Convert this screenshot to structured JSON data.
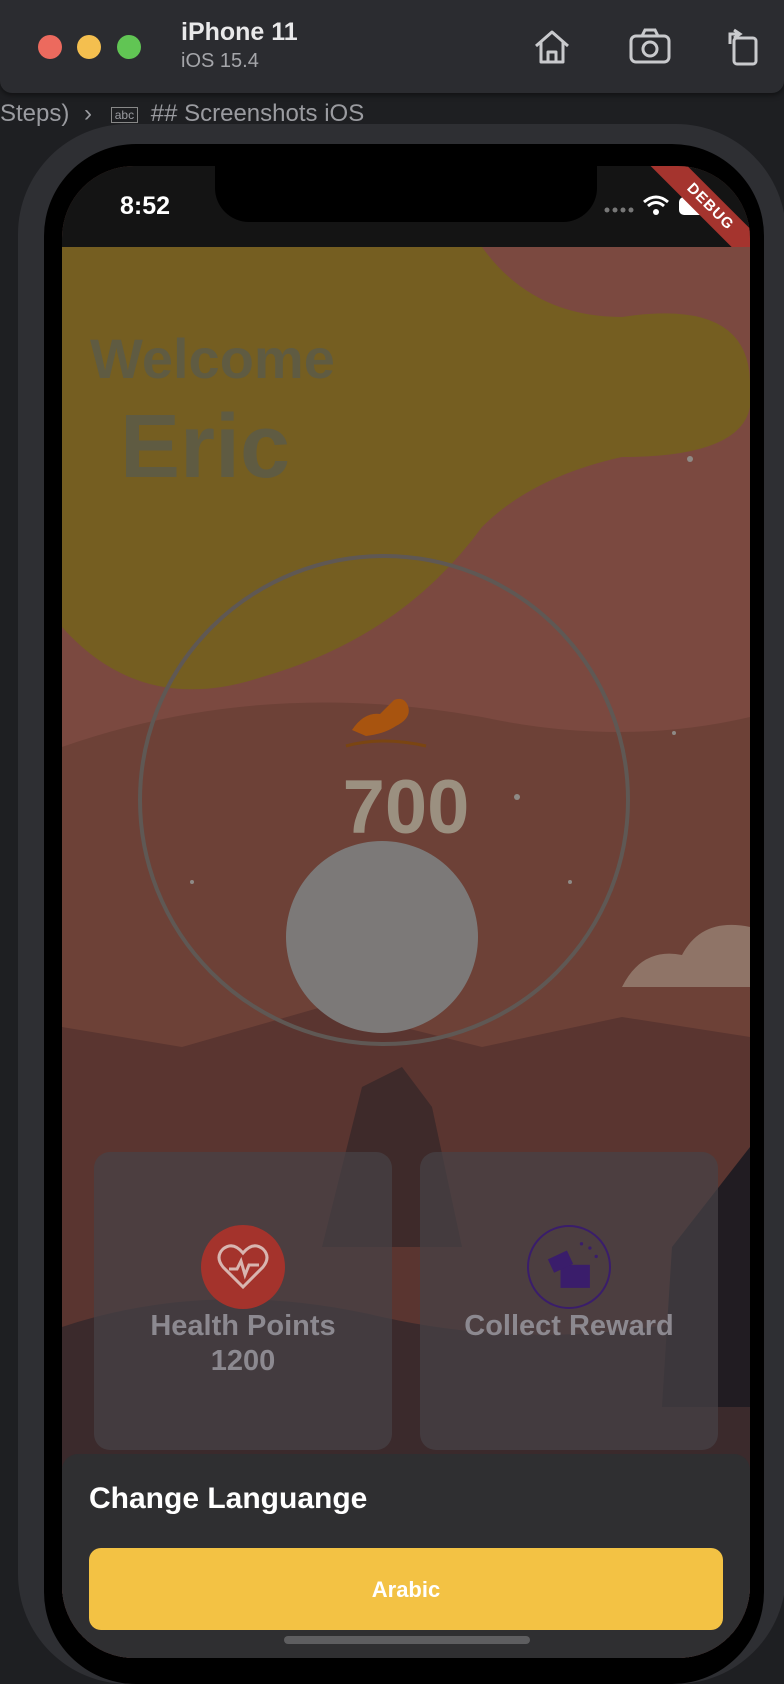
{
  "simulator": {
    "device_name": "iPhone 11",
    "os_version": "iOS 15.4",
    "toolbar": {
      "home": "home-icon",
      "screenshot": "camera-icon",
      "rotate": "rotate-icon"
    }
  },
  "editor": {
    "breadcrumb_left": "Steps)",
    "breadcrumb_abc": "abc",
    "breadcrumb_heading": "## Screenshots iOS"
  },
  "status_bar": {
    "time": "8:52",
    "debug_banner": "DEBUG"
  },
  "home": {
    "welcome": "Welcome",
    "user_name": "Eric",
    "steps": "700",
    "cards": [
      {
        "title": "Health Points",
        "value": "1200",
        "icon": "heart-pulse-icon"
      },
      {
        "title": "Collect Reward",
        "icon": "gift-icon"
      }
    ]
  },
  "language_sheet": {
    "title": "Change Languange",
    "button_label": "Arabic"
  },
  "colors": {
    "accent_yellow": "#f3c244",
    "debug_red": "#a5342e",
    "health_red": "#a4332c",
    "reward_purple": "#3a1d6b"
  }
}
